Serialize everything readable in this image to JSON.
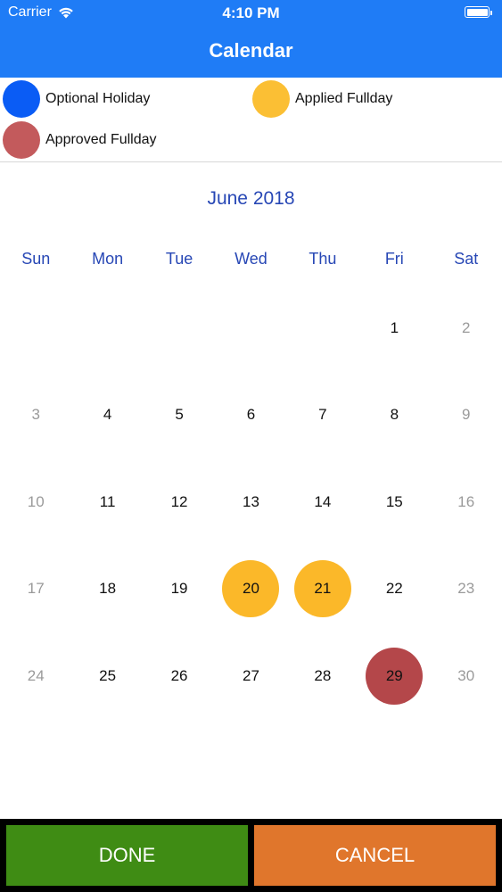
{
  "status_bar": {
    "carrier": "Carrier",
    "time": "4:10 PM",
    "icons": [
      "wifi-icon",
      "battery-icon"
    ]
  },
  "header": {
    "title": "Calendar"
  },
  "legend": {
    "items": [
      {
        "label": "Optional Holiday",
        "color": "#0a5cf5"
      },
      {
        "label": "Applied Fullday",
        "color": "#fbbf34"
      },
      {
        "label": "Approved Fullday",
        "color": "#c35a5c"
      }
    ]
  },
  "calendar": {
    "month_title": "June 2018",
    "weekdays": [
      "Sun",
      "Mon",
      "Tue",
      "Wed",
      "Thu",
      "Fri",
      "Sat"
    ],
    "weeks": [
      [
        "",
        "",
        "",
        "",
        "",
        "1",
        "2"
      ],
      [
        "3",
        "4",
        "5",
        "6",
        "7",
        "8",
        "9"
      ],
      [
        "10",
        "11",
        "12",
        "13",
        "14",
        "15",
        "16"
      ],
      [
        "17",
        "18",
        "19",
        "20",
        "21",
        "22",
        "23"
      ],
      [
        "24",
        "25",
        "26",
        "27",
        "28",
        "29",
        "30"
      ]
    ],
    "applied_days": [
      "20",
      "21"
    ],
    "approved_days": [
      "29"
    ],
    "colors": {
      "applied": "#fbb829",
      "approved": "#b4474a",
      "weekday_text": "#2747b5"
    }
  },
  "footer": {
    "done_label": "DONE",
    "cancel_label": "CANCEL",
    "done_color": "#3f8c14",
    "cancel_color": "#e0762c"
  }
}
